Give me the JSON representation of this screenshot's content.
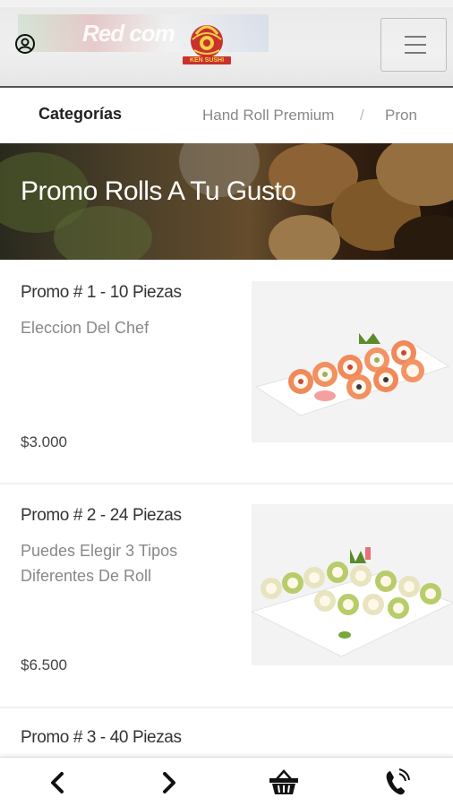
{
  "header": {
    "banner_text": "Red com",
    "logo_text": "KEN SUSHI",
    "icons": {
      "user": "user-circle-icon",
      "menu": "hamburger-menu-icon"
    }
  },
  "tabs": {
    "categories_label": "Categorías",
    "items": [
      "Hand Roll Premium",
      "Pron"
    ]
  },
  "category": {
    "title": "Promo Rolls A Tu Gusto"
  },
  "products": [
    {
      "name": "Promo # 1 - 10 Piezas",
      "description": "Eleccion Del Chef",
      "price": "$3.000"
    },
    {
      "name": "Promo # 2 - 24 Piezas",
      "description": "Puedes Elegir 3 Tipos Diferentes De Roll",
      "price": "$6.500"
    },
    {
      "name": "Promo # 3 - 40 Piezas",
      "description": "",
      "price": ""
    }
  ],
  "bottom_nav": {
    "icons": [
      "chevron-left-icon",
      "chevron-right-icon",
      "basket-icon",
      "phone-icon"
    ]
  },
  "colors": {
    "logo_red": "#c8322a",
    "logo_gold": "#f5d04a",
    "salmon": "#f08a5a"
  }
}
